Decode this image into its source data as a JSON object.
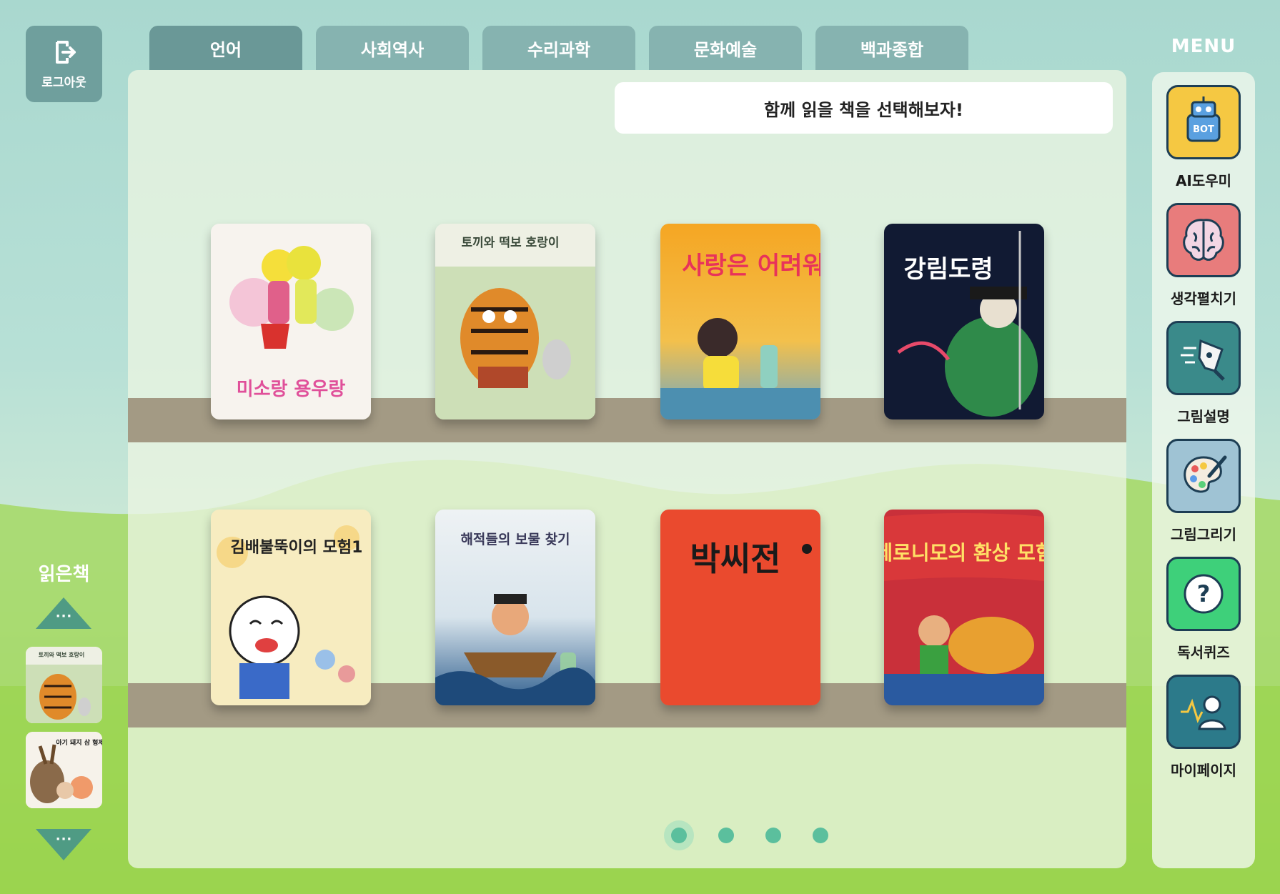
{
  "logout": {
    "label": "로그아웃",
    "icon": "logout-icon"
  },
  "tabs": [
    {
      "label": "언어",
      "active": true
    },
    {
      "label": "사회역사",
      "active": false
    },
    {
      "label": "수리과학",
      "active": false
    },
    {
      "label": "문화예술",
      "active": false
    },
    {
      "label": "백과종합",
      "active": false
    }
  ],
  "menu": {
    "title": "MENU",
    "items": [
      {
        "label": "AI도우미",
        "icon": "robot-icon",
        "color": "#f5c842"
      },
      {
        "label": "생각펼치기",
        "icon": "brain-icon",
        "color": "#e87c7c"
      },
      {
        "label": "그림설명",
        "icon": "pen-icon",
        "color": "#3a8a8a"
      },
      {
        "label": "그림그리기",
        "icon": "palette-icon",
        "color": "#9fc3d4"
      },
      {
        "label": "독서퀴즈",
        "icon": "question-icon",
        "color": "#3ed07a"
      },
      {
        "label": "마이페이지",
        "icon": "profile-icon",
        "color": "#2c7a8a"
      }
    ]
  },
  "banner": {
    "text": "함께 읽을 책을 선택해보자!"
  },
  "books": [
    {
      "title": "미소랑 용우랑",
      "bg": "#f7f3ee",
      "accent": "#e0509a"
    },
    {
      "title": "토끼와 떡보 호랑이",
      "bg": "#eef0e4",
      "accent": "#3a4a3a"
    },
    {
      "title": "사랑은 어려워",
      "bg": "#f2b44a",
      "accent": "#e8335a"
    },
    {
      "title": "강림도령",
      "bg": "#111a33",
      "accent": "#ffffff"
    },
    {
      "title": "김배불뚝이의 모험1",
      "bg": "#f7ecc0",
      "accent": "#222222"
    },
    {
      "title": "해적들의 보물 찾기",
      "bg": "#e8eef2",
      "accent": "#3a3a5a"
    },
    {
      "title": "박씨전",
      "bg": "#ea4a2e",
      "accent": "#1a1a1a"
    },
    {
      "title": "제로니모의 환상 모험",
      "bg": "#c9303a",
      "accent": "#ffe066"
    }
  ],
  "pagination": {
    "pages": 4,
    "current": 1
  },
  "read_books": {
    "title": "읽은책",
    "more_up": "···",
    "more_down": "···",
    "items": [
      {
        "title": "토끼와 떡보 호랑이"
      },
      {
        "title": "아기 돼지 삼 형제"
      }
    ]
  }
}
